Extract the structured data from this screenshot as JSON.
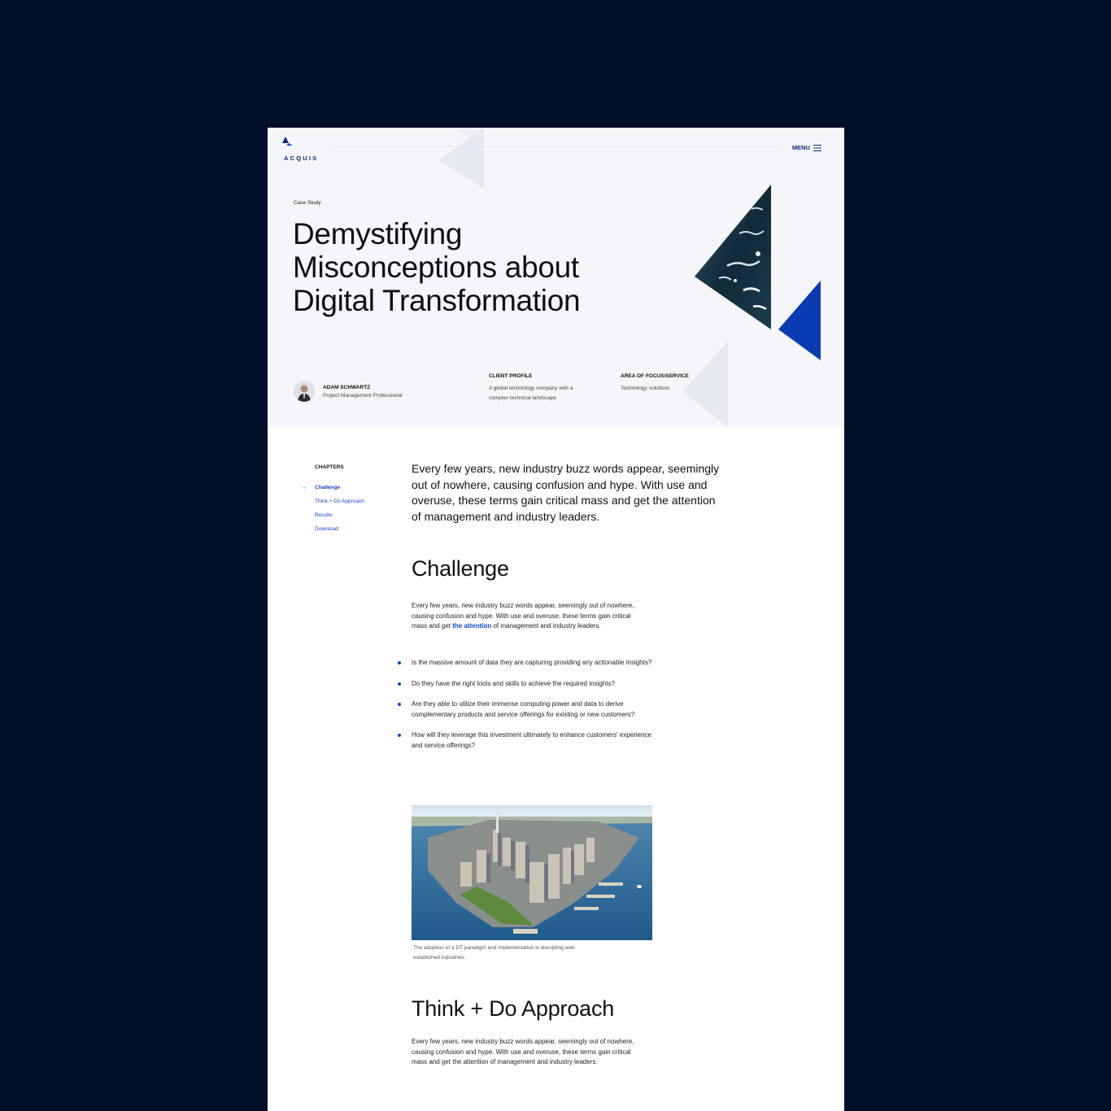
{
  "header": {
    "logo_text": "ACQUIS",
    "menu_label": "MENU"
  },
  "hero": {
    "eyebrow": "Case Study",
    "title": "Demystifying Misconceptions about Digital Transformation",
    "author": {
      "name": "ADAM SCHWARTZ",
      "role": "Project Management Professional"
    },
    "client_profile": {
      "heading": "CLIENT PROFILE",
      "text": "A global technology company with a complex technical landscape"
    },
    "focus": {
      "heading": "AREA OF FOCUS/SERVICE",
      "text": "Technology solutions"
    }
  },
  "chapters": {
    "heading": "CHAPTERS",
    "active_marker": "→",
    "items": [
      {
        "label": "Challenge",
        "active": true
      },
      {
        "label": "Think + Do Approach",
        "active": false
      },
      {
        "label": "Results",
        "active": false
      },
      {
        "label": "Download",
        "active": false
      }
    ]
  },
  "content": {
    "lead": "Every few years, new industry buzz words appear, seemingly out of nowhere, causing confusion and hype. With use and overuse, these terms gain critical mass and get the attention of management and industry leaders.",
    "challenge": {
      "title": "Challenge",
      "para_before": "Every few years, new industry buzz words appear, seemingly out of nowhere, causing confusion and hype. With use and overuse, these terms gain critical mass and get ",
      "para_link": "the attention",
      "para_after": " of management and industry leaders.",
      "bullets": [
        "Is the massive amount of data they are capturing providing any actionable insights?",
        "Do they have the right tools and skills to achieve the required insights?",
        "Are they able to utilize their immense computing power and data to derive complementary products and service offerings for existing or new customers?",
        "How will they leverage this investment ultimately to enhance customers' experience and service offerings?"
      ],
      "caption": "The adoption of a DT paradigm and implementation is disrupting well-established industries."
    },
    "approach": {
      "title": "Think + Do Approach",
      "para": "Every few years, new industry buzz words appear, seemingly out of nowhere, causing confusion and hype. With use and overuse, these terms gain critical mass and get the attention of management and industry leaders."
    }
  },
  "colors": {
    "background": "#010f29",
    "accent": "#1546c8",
    "brand_triangle": "#0a3bb3",
    "hero_bg": "#f4f6f9"
  }
}
